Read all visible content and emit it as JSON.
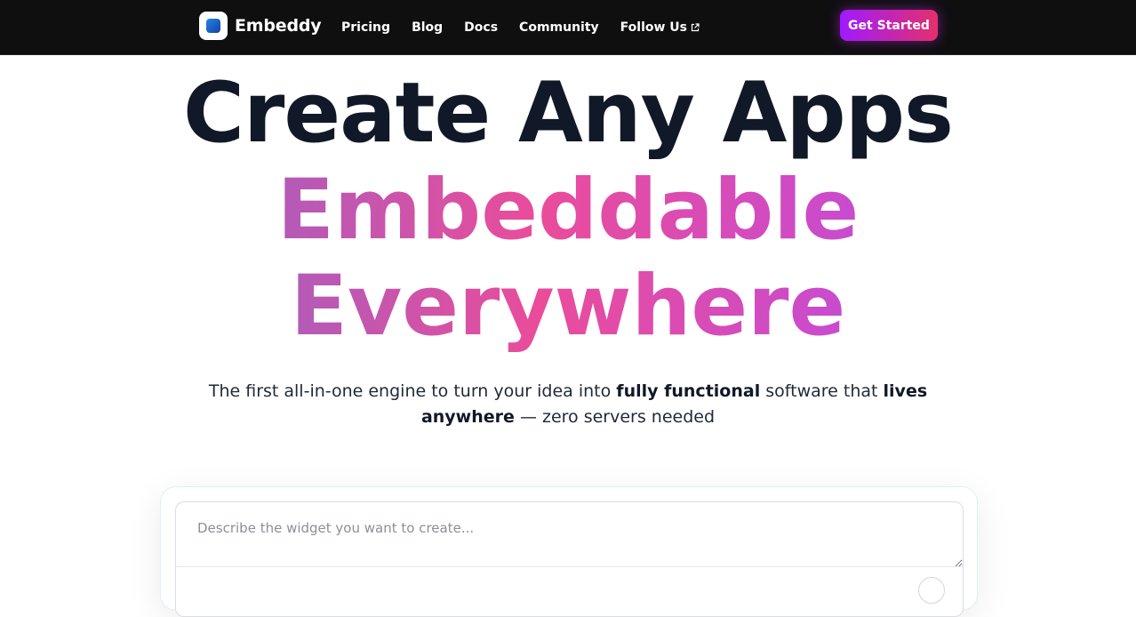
{
  "brand": {
    "name": "Embeddy"
  },
  "nav": {
    "links": [
      "Pricing",
      "Blog",
      "Docs",
      "Community",
      "Follow Us"
    ],
    "follow_icon": "external-link-icon",
    "cta_label": "Get Started"
  },
  "hero": {
    "line1": "Create Any Apps",
    "line2": "Embeddable",
    "line3": "Everywhere"
  },
  "subtitle": {
    "part1": "The first all-in-one engine to turn your idea into ",
    "bold1": "fully functional",
    "part2": " software that ",
    "bold2": "lives anywhere",
    "part3": " — zero servers needed"
  },
  "prompt": {
    "placeholder": "Describe the widget you want to create..."
  },
  "colors": {
    "nav_bg": "#0f0f10",
    "cta_start": "#a01aff",
    "cta_end": "#e4306c",
    "gradient_text_start": "#b35bb8",
    "gradient_text_mid": "#ea4c9a",
    "heading": "#111827"
  }
}
